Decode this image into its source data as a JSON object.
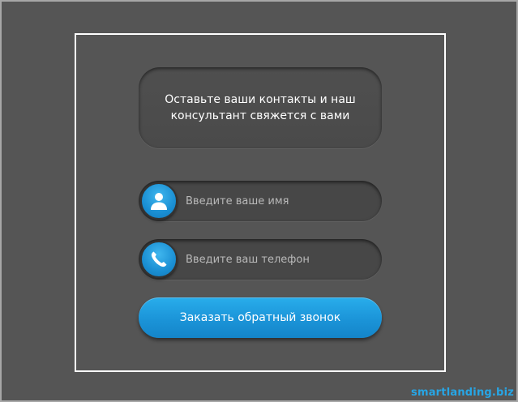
{
  "form": {
    "message": "Оставьте ваши контакты и наш консультант свяжется с вами",
    "name_field": {
      "icon": "user-icon",
      "placeholder": "Введите ваше имя",
      "value": ""
    },
    "phone_field": {
      "icon": "phone-icon",
      "placeholder": "Введите ваш телефон",
      "value": ""
    },
    "submit_label": "Заказать обратный звонок"
  },
  "footer": {
    "watermark": "smartlanding.biz"
  },
  "colors": {
    "background": "#555555",
    "frame": "#ffffff",
    "accent": "#1b94d8",
    "watermark": "#27a6e6"
  }
}
